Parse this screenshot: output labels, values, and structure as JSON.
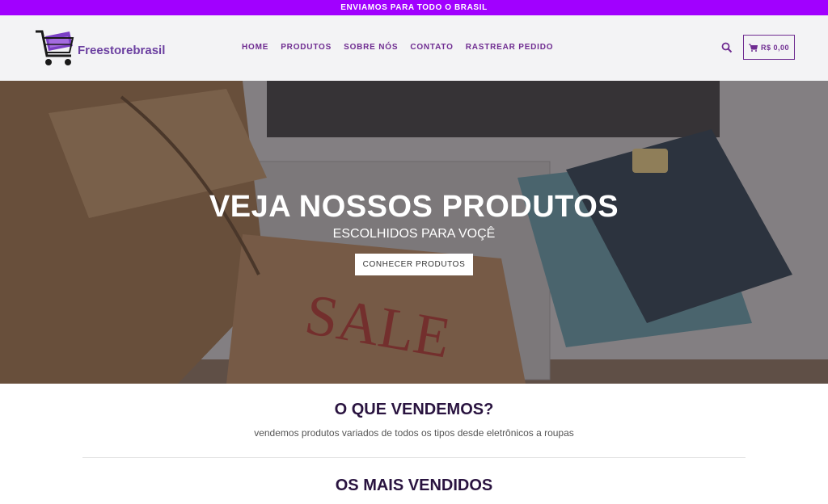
{
  "topbar": {
    "text": "ENVIAMOS PARA TODO O BRASIL"
  },
  "header": {
    "logo_text": "Freestorebrasil",
    "nav": [
      "HOME",
      "PRODUTOS",
      "SOBRE NÓS",
      "CONTATO",
      "RASTREAR PEDIDO"
    ],
    "cart_total": "R$ 0,00",
    "search_icon": "search-icon",
    "cart_icon": "cart-icon"
  },
  "hero": {
    "title": "VEJA NOSSOS PRODUTOS",
    "subtitle": "ESCOLHIDOS PARA VOÇÊ",
    "button": "CONHECER PRODUTOS"
  },
  "sections": {
    "what_we_sell_title": "O QUE VENDEMOS?",
    "what_we_sell_text": "vendemos produtos variados de todos os tipos desde eletrônicos a roupas",
    "best_sellers_title": "OS MAIS VENDIDOS"
  },
  "colors": {
    "accent": "#a100ff",
    "brand": "#6f2c91"
  }
}
